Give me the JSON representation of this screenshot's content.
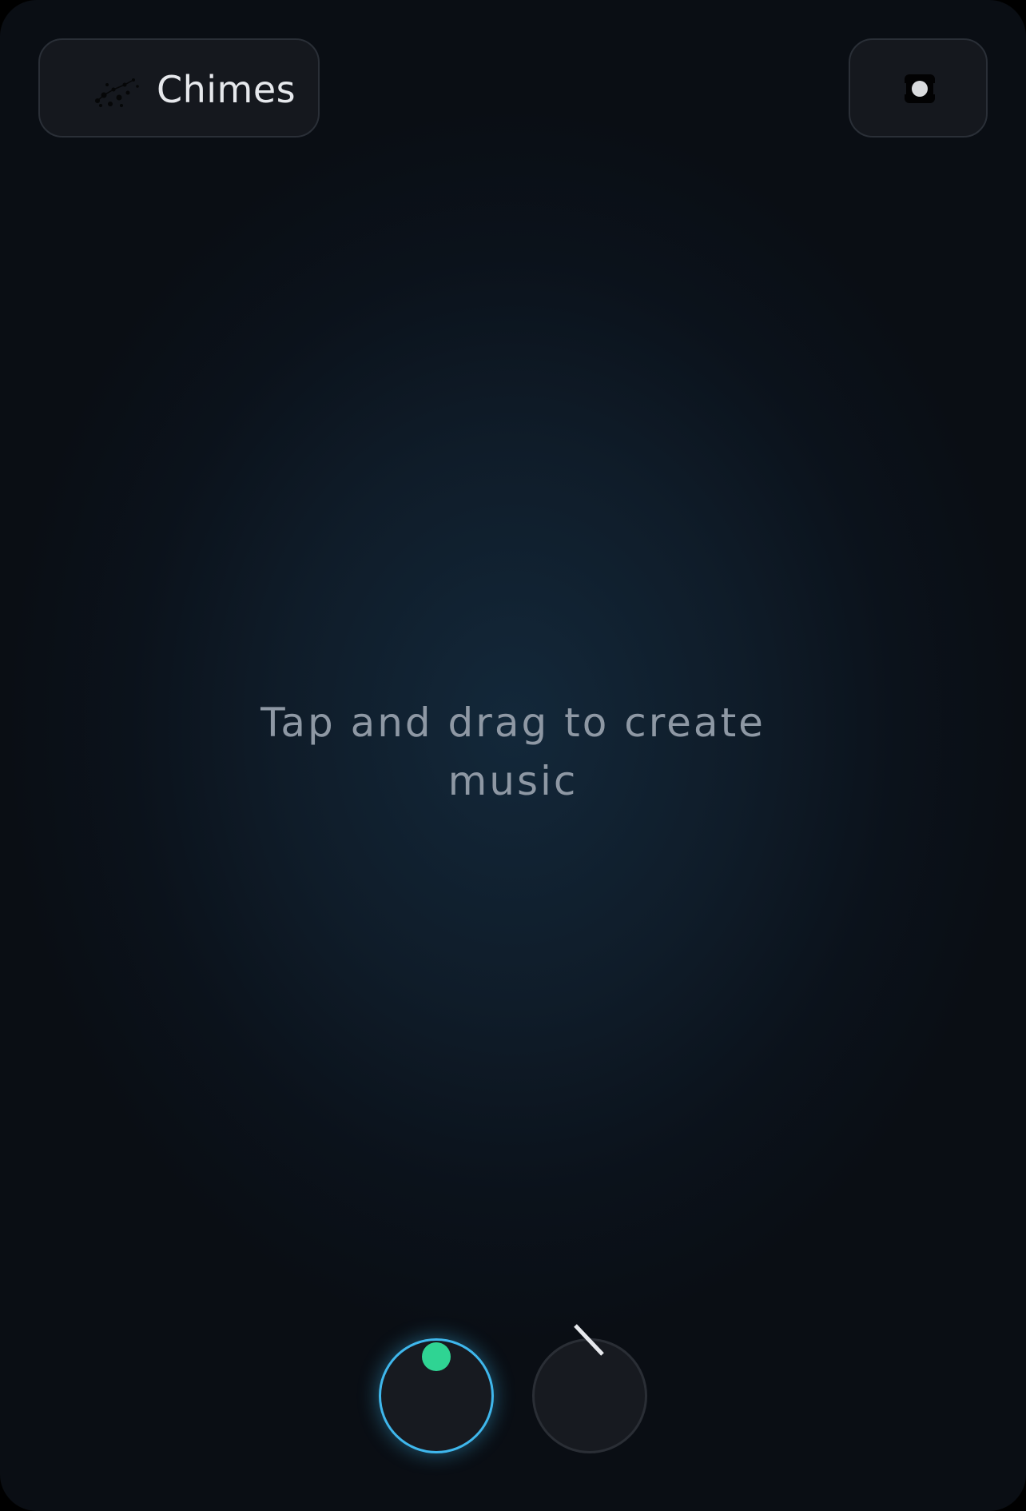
{
  "header": {
    "instrument_label": "Chimes",
    "instrument_icon": "chimes-icon",
    "record_icon": "record-icon"
  },
  "main": {
    "hint": "Tap and drag to create music"
  },
  "controls": {
    "knobs": [
      {
        "name": "knob-left",
        "active": true,
        "indicator": "dot"
      },
      {
        "name": "knob-right",
        "active": false,
        "indicator": "needle"
      }
    ]
  },
  "colors": {
    "accent": "#3fb7ec",
    "indicator": "#2fd493"
  }
}
